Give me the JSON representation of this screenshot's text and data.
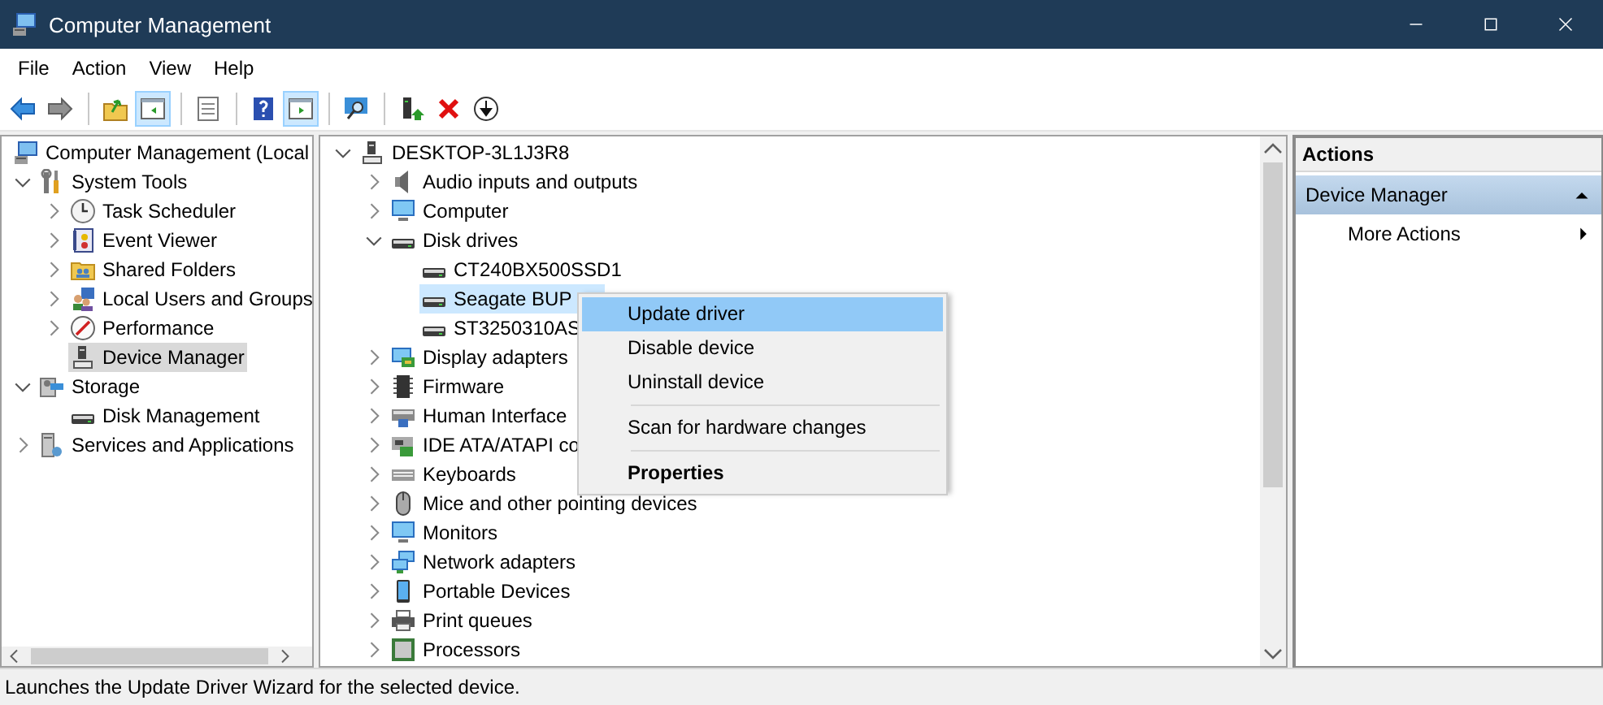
{
  "window": {
    "title": "Computer Management"
  },
  "menu_bar": [
    "File",
    "Action",
    "View",
    "Help"
  ],
  "toolbar": [
    [
      {
        "pressed": false
      },
      {
        "pressed": false
      }
    ],
    [
      {
        "pressed": false
      },
      {
        "pressed": true
      }
    ],
    [
      {
        "pressed": false
      }
    ],
    [
      {
        "pressed": false
      },
      {
        "pressed": true
      }
    ],
    [
      {
        "pressed": false
      }
    ],
    [
      {
        "pressed": false
      },
      {
        "pressed": false
      },
      {
        "pressed": false
      }
    ]
  ],
  "console_tree": [
    {
      "label": "Computer Management (Local",
      "selected": false,
      "children": [
        {
          "label": "System Tools",
          "expanded": true,
          "selected": false,
          "children": [
            {
              "label": "Task Scheduler",
              "expanded": false,
              "selected": false
            },
            {
              "label": "Event Viewer",
              "expanded": false,
              "selected": false
            },
            {
              "label": "Shared Folders",
              "expanded": false,
              "selected": false
            },
            {
              "label": "Local Users and Groups",
              "expanded": false,
              "selected": false
            },
            {
              "label": "Performance",
              "expanded": false,
              "selected": false
            },
            {
              "label": "Device Manager",
              "selected": true
            }
          ]
        },
        {
          "label": "Storage",
          "expanded": true,
          "selected": false,
          "children": [
            {
              "label": "Disk Management",
              "selected": false
            }
          ]
        },
        {
          "label": "Services and Applications",
          "expanded": false,
          "selected": false
        }
      ]
    }
  ],
  "device_tree": [
    {
      "label": "DESKTOP-3L1J3R8",
      "expanded": true,
      "selected": false,
      "children": [
        {
          "label": "Audio inputs and outputs",
          "expanded": false,
          "selected": false
        },
        {
          "label": "Computer",
          "expanded": false,
          "selected": false
        },
        {
          "label": "Disk drives",
          "expanded": true,
          "selected": false,
          "children": [
            {
              "label": "CT240BX500SSD1",
              "selected": false
            },
            {
              "label": "Seagate BUP",
              "selected": true
            },
            {
              "label": "ST3250310AS",
              "selected": false
            }
          ]
        },
        {
          "label": "Display adapters",
          "expanded": false,
          "selected": false
        },
        {
          "label": "Firmware",
          "expanded": false,
          "selected": false
        },
        {
          "label": "Human Interface",
          "expanded": false,
          "selected": false
        },
        {
          "label": "IDE ATA/ATAPI co",
          "expanded": false,
          "selected": false
        },
        {
          "label": "Keyboards",
          "expanded": false,
          "selected": false
        },
        {
          "label": "Mice and other pointing devices",
          "expanded": false,
          "selected": false
        },
        {
          "label": "Monitors",
          "expanded": false,
          "selected": false
        },
        {
          "label": "Network adapters",
          "expanded": false,
          "selected": false
        },
        {
          "label": "Portable Devices",
          "expanded": false,
          "selected": false
        },
        {
          "label": "Print queues",
          "expanded": false,
          "selected": false
        },
        {
          "label": "Processors",
          "expanded": false,
          "selected": false
        }
      ]
    }
  ],
  "context_menu": {
    "items": [
      {
        "kind": "command",
        "label": "Update driver",
        "selected": true,
        "default": false
      },
      {
        "kind": "command",
        "label": "Disable device",
        "selected": false,
        "default": false
      },
      {
        "kind": "command",
        "label": "Uninstall device",
        "selected": false,
        "default": false
      },
      {
        "kind": "separator"
      },
      {
        "kind": "command",
        "label": "Scan for hardware changes",
        "selected": false,
        "default": false
      },
      {
        "kind": "separator"
      },
      {
        "kind": "command",
        "label": "Properties",
        "selected": false,
        "default": true
      }
    ]
  },
  "actions_pane": {
    "title": "Actions",
    "sections": [
      {
        "title": "Device Manager",
        "expanded": true,
        "items": [
          {
            "label": "More Actions"
          }
        ]
      }
    ]
  },
  "status_bar": {
    "text": "Launches the Update Driver Wizard for the selected device."
  }
}
